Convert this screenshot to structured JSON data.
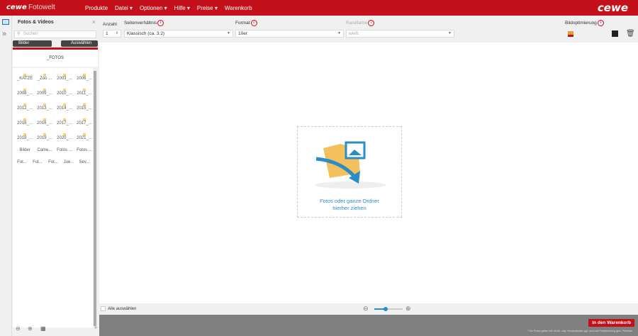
{
  "header": {
    "logo": "cewe",
    "app_title": "Fotowelt",
    "menu": [
      "Produkte",
      "Datei ▾",
      "Optionen ▾",
      "Hilfe ▾",
      "Preise ▾",
      "Warenkorb"
    ],
    "logo_right": "cewe"
  },
  "panel": {
    "title": "Fotos & Videos",
    "search_placeholder": "Suchen",
    "bilder_button": "Bilder",
    "select_button": "Auswählen",
    "current_folder": "_FOTOS",
    "folders": [
      "_KATZE",
      "_Zoo ...",
      "2003_...",
      "2006_...",
      "2008_...",
      "2009_...",
      "2010_...",
      "2011_...",
      "2012_...",
      "2013_...",
      "2014_...",
      "2015_...",
      "2016_...",
      "2016_...",
      "2017_...",
      "2017_...",
      "2018_...",
      "2019_...",
      "2020_...",
      "2021_...",
      "Bilder",
      "Came...",
      "Fotos ...",
      "Fotos ...",
      "Fot...",
      "Fot...",
      "Fot...",
      "Jue...",
      "Sev..."
    ]
  },
  "toolbar": {
    "anzahl_label": "Anzahl",
    "anzahl_value": "1",
    "ratio_label": "Seitenverhältnis",
    "ratio_value": "Klassisch (ca. 3:2)",
    "format_label": "Format",
    "format_value": "10er",
    "border_label": "Randfarbe",
    "border_value": "weiß",
    "optim_label": "Bildoptimierung"
  },
  "dropzone": {
    "line1": "Fotos oder ganze Ordner",
    "line2": "hierher ziehen"
  },
  "bottom": {
    "select_all": "Alle auswählen",
    "zoom_level": 0.4
  },
  "footer": {
    "cart_button": "In den Warenkorb",
    "note": "* Die Preise gelten inkl. MwSt. zzgl. Versandkosten ggf. auch bei Preisänderung gem. Preisliste"
  },
  "colors": {
    "brand": "#c4101a",
    "accent": "#2a8ec6"
  }
}
